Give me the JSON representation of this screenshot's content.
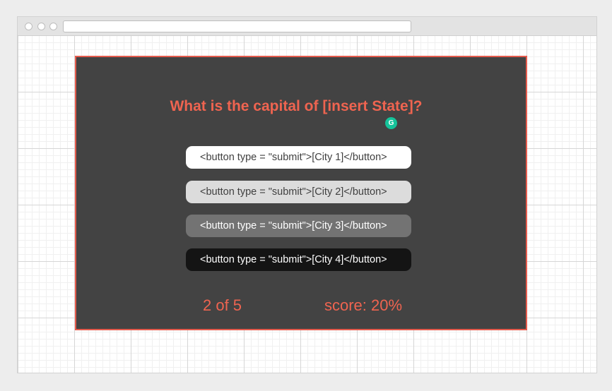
{
  "window": {
    "url": ""
  },
  "quiz": {
    "question": "What is the capital of [insert State]?",
    "answers": [
      {
        "label": "<button type = \"submit\">[City 1]</button>"
      },
      {
        "label": "<button type = \"submit\">[City 2]</button>"
      },
      {
        "label": "<button type = \"submit\">[City 3]</button>"
      },
      {
        "label": "<button type = \"submit\">[City 4]</button>"
      }
    ],
    "progress": "2 of 5",
    "score": "score: 20%"
  },
  "colors": {
    "accent": "#ef6450",
    "panel_background": "#434343",
    "panel_border": "#e55b4d",
    "grammarly": "#15c39a"
  },
  "icons": {
    "grammarly": "grammarly-icon"
  }
}
